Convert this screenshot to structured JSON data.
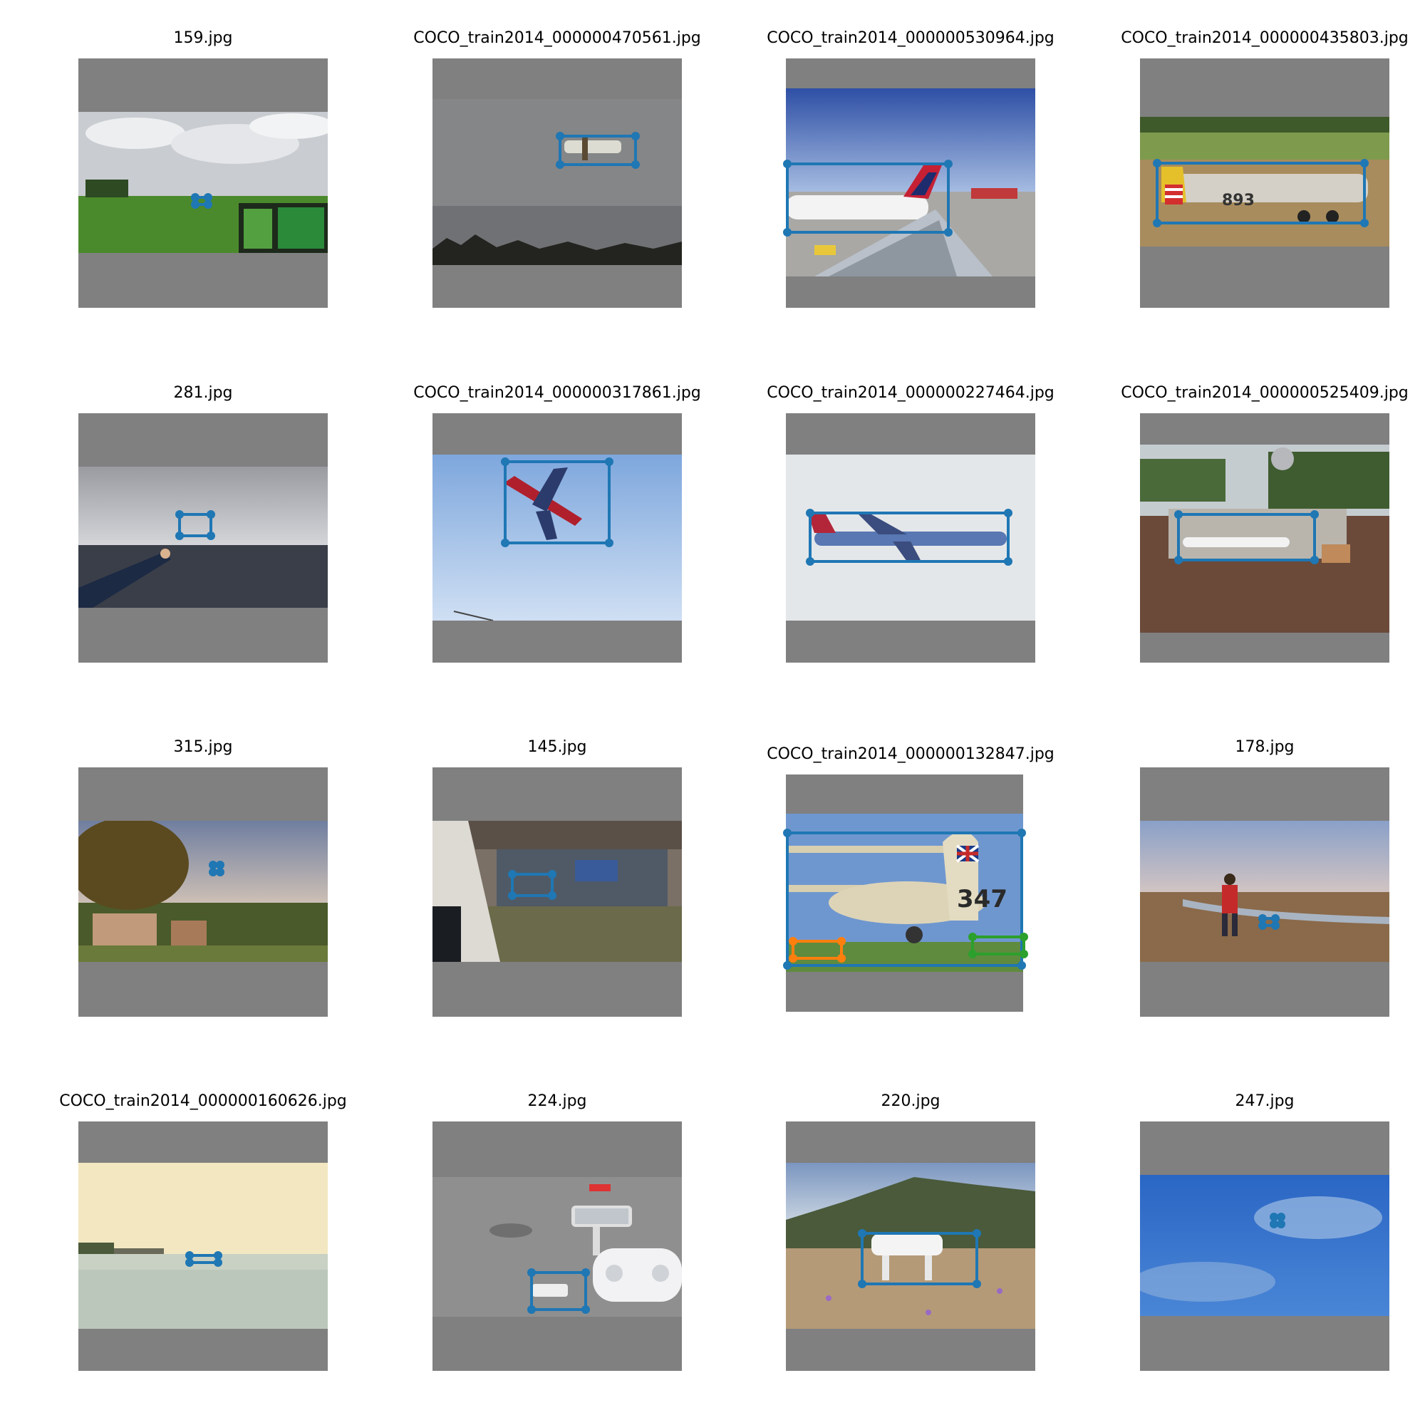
{
  "grid": {
    "colors": {
      "box_blue": "#1f77b4",
      "box_orange": "#ff7f0e",
      "box_green": "#2ca02c",
      "padding_gray": "#808080"
    },
    "cells": [
      {
        "title": "159.jpg",
        "scene": "cloudy sky over green field with drone and app overlay"
      },
      {
        "title": "COCO_train2014_000000470561.jpg",
        "scene": "small propeller plane in overcast gray sky"
      },
      {
        "title": "COCO_train2014_000000530964.jpg",
        "scene": "Delta airliner seen over a wing at an airport"
      },
      {
        "title": "COCO_train2014_000000435803.jpg",
        "scene": "vintage yellow-tail trainer plane on grass"
      },
      {
        "title": "281.jpg",
        "scene": "hand reaching toward drone over the sea"
      },
      {
        "title": "COCO_train2014_000000317861.jpg",
        "scene": "red jet overhead in blue sky"
      },
      {
        "title": "COCO_train2014_000000227464.jpg",
        "scene": "long-haul jet in pale sky"
      },
      {
        "title": "COCO_train2014_000000525409.jpg",
        "scene": "model airport diorama with airliner"
      },
      {
        "title": "315.jpg",
        "scene": "house and tree under evening sky with drone"
      },
      {
        "title": "145.jpg",
        "scene": "graffiti ruins with drone near shoulder"
      },
      {
        "title": "COCO_train2014_000000132847.jpg",
        "scene": "vintage biplane with union jack tail"
      },
      {
        "title": "178.jpg",
        "scene": "person on tidal flat with drone"
      },
      {
        "title": "COCO_train2014_000000160626.jpg",
        "scene": "distant aircraft over calm bay"
      },
      {
        "title": "224.jpg",
        "scene": "drone and remote controller on pavement"
      },
      {
        "title": "220.jpg",
        "scene": "white drone among crocus flowers on hillside"
      },
      {
        "title": "247.jpg",
        "scene": "drone in blue sky with clouds"
      }
    ]
  },
  "labels": {
    "plane4_number": "893",
    "plane11_number": "347"
  }
}
